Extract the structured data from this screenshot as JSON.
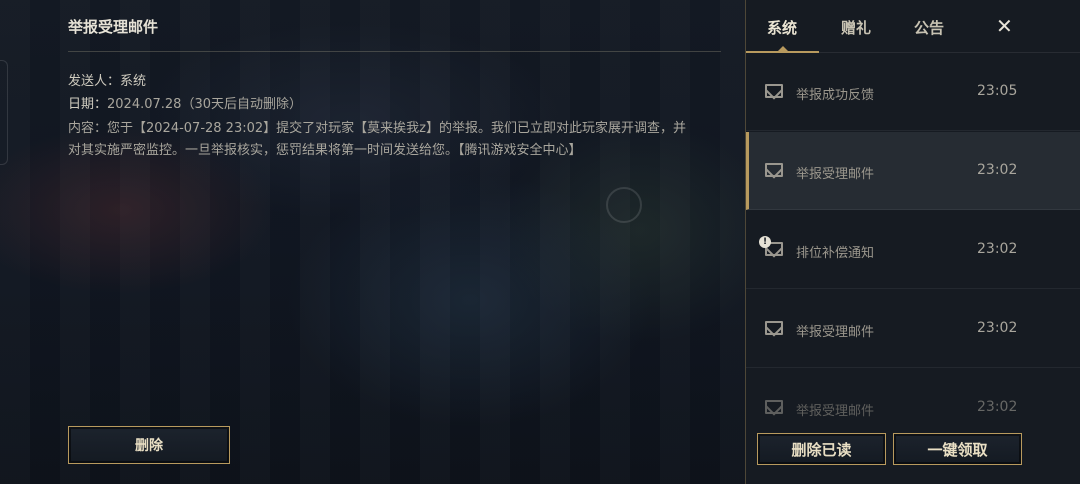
{
  "detail": {
    "title": "举报受理邮件",
    "sender_label": "发送人：",
    "sender": "系统",
    "date_label": "日期：",
    "date": "2024.07.28",
    "retention": "（30天后自动删除）",
    "content": "内容：您于【2024-07-28 23:02】提交了对玩家【莫来挨我z】的举报。我们已立即对此玩家展开调查，并对其实施严密监控。一旦举报核实，惩罚结果将第一时间发送给您。【腾讯游戏安全中心】",
    "delete_label": "删除"
  },
  "tabs": [
    {
      "label": "系统",
      "active": true
    },
    {
      "label": "赠礼",
      "active": false
    },
    {
      "label": "公告",
      "active": false
    }
  ],
  "close_label": "✕",
  "mails": [
    {
      "subject": "举报成功反馈",
      "time": "23:05",
      "icon": "envelope-icon"
    },
    {
      "subject": "举报受理邮件",
      "time": "23:02",
      "icon": "envelope-icon",
      "selected": true
    },
    {
      "subject": "排位补偿通知",
      "time": "23:02",
      "icon": "envelope-alert-icon"
    },
    {
      "subject": "举报受理邮件",
      "time": "23:02",
      "icon": "envelope-icon"
    },
    {
      "subject": "举报受理邮件",
      "time": "23:02",
      "icon": "envelope-icon"
    }
  ],
  "actions": {
    "delete_read": "删除已读",
    "claim_all": "一键领取"
  },
  "colors": {
    "accent_gold": "#b89a5e",
    "panel_bg": "#161b22",
    "selected_bg": "#262c33"
  }
}
